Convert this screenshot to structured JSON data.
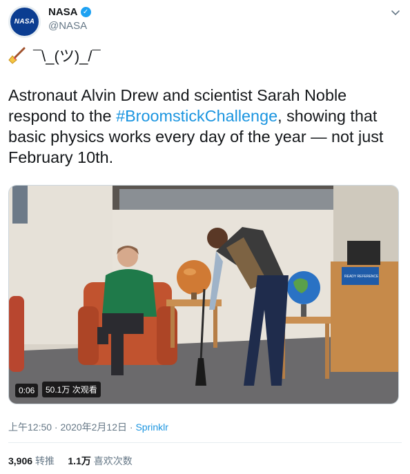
{
  "author": {
    "name": "NASA",
    "handle": "@NASA",
    "avatar_text": "NASA",
    "verified_icon": "verified-checkmark-icon"
  },
  "menu_icon": "chevron-down-icon",
  "emoji_line": {
    "emoji_icon": "broom-icon",
    "text": "¯\\_(ツ)_/¯"
  },
  "tweet": {
    "text_part1": "Astronaut Alvin Drew and scientist Sarah Noble respond to the ",
    "hashtag": "#BroomstickChallenge",
    "text_part2": ", showing that basic physics works every day of the year — not just February 10th."
  },
  "video": {
    "duration": "0:06",
    "views": "50.1万 次观看",
    "sign_text": "READY REFERENCE"
  },
  "timestamp": {
    "time": "上午12:50",
    "sep": " · ",
    "date": "2020年2月12日",
    "sep2": " · ",
    "source": "Sprinklr"
  },
  "stats": {
    "retweets_count": "3,906",
    "retweets_label": "转推",
    "likes_count": "1.1万",
    "likes_label": "喜欢次数"
  },
  "colors": {
    "link": "#1b95e0",
    "verified": "#1da1f2",
    "muted": "#657786",
    "nasa_blue": "#0b3d91"
  }
}
